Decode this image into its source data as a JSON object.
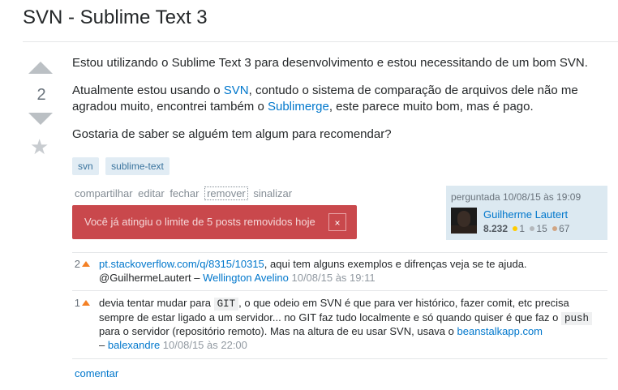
{
  "question": {
    "title": "SVN - Sublime Text 3",
    "score": "2",
    "paragraphs": {
      "p1": "Estou utilizando o Sublime Text 3 para desenvolvimento e estou necessitando de um bom SVN.",
      "p2_a": "Atualmente estou usando o ",
      "p2_link1": "SVN",
      "p2_b": ", contudo o sistema de comparação de arquivos dele não me",
      "p3_a": "agradou muito, encontrei também o ",
      "p3_link2": "Sublimerge",
      "p3_b": ", este parece muito bom, mas é pago.",
      "p4": "Gostaria de saber se alguém tem algum para recomendar?"
    },
    "tags": [
      "svn",
      "sublime-text"
    ]
  },
  "post_menu": {
    "share": "compartilhar",
    "edit": "editar",
    "close": "fechar",
    "remove": "remover",
    "flag": "sinalizar"
  },
  "alert": {
    "message": "Você já atingiu o limite de 5 posts removidos hoje",
    "close": "×"
  },
  "owner": {
    "asked": "perguntada 10/08/15 às 19:09",
    "name": "Guilherme Lautert",
    "reputation": "8.232",
    "gold": "1",
    "silver": "15",
    "bronze": "67",
    "colors": {
      "gold": "#ffcc01",
      "silver": "#b4b8bc",
      "bronze": "#d1a684"
    }
  },
  "comments": [
    {
      "score": "2",
      "link": "pt.stackoverflow.com/q/8315/10315",
      "text1": ", aqui tem alguns exemplos e difrenças veja se te ajuda.",
      "text2": "@GuilhermeLautert – ",
      "user": "Wellington Avelino",
      "date": "10/08/15 às 19:11"
    },
    {
      "score": "1",
      "l1_a": "devia tentar mudar para ",
      "l1_code": "GIT",
      "l1_b": ", o que odeio em SVN é que para ver histórico, fazer comit, etc precisa",
      "l2_a": "sempre de estar ligado a um servidor... no GIT faz tudo localmente e só quando quiser é que faz o ",
      "l2_code": "push",
      "l3_a": "para o servidor (repositório remoto). Mas na altura de eu usar SVN, usava o ",
      "l3_link": "beanstalkapp.com",
      "l4_dash": "– ",
      "user": "balexandre",
      "date": "10/08/15 às 22:00"
    }
  ],
  "add_comment": "comentar",
  "icons": {
    "upvote": "arrow-up-icon",
    "downvote": "arrow-down-icon",
    "favorite": "star-icon"
  }
}
